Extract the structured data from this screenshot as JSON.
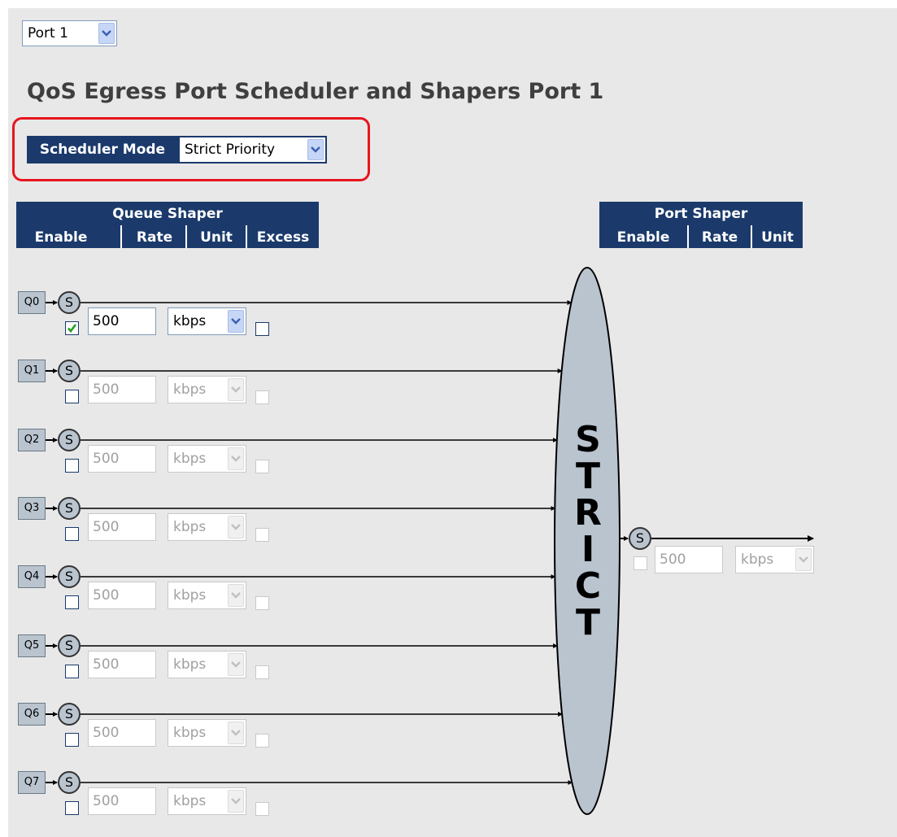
{
  "port_select": {
    "value": "Port 1"
  },
  "title": "QoS Egress Port Scheduler and Shapers  Port 1",
  "scheduler": {
    "label": "Scheduler Mode",
    "value": "Strict Priority"
  },
  "queue_shaper": {
    "header": "Queue Shaper",
    "columns": [
      "Enable",
      "Rate",
      "Unit",
      "Excess"
    ]
  },
  "port_shaper": {
    "header": "Port Shaper",
    "columns": [
      "Enable",
      "Rate",
      "Unit"
    ],
    "scheduler_symbol": "S",
    "enabled": false,
    "rate": "500",
    "unit": "kbps"
  },
  "strict_label": [
    "S",
    "T",
    "R",
    "I",
    "C",
    "T"
  ],
  "queues": [
    {
      "label": "Q0",
      "symbol": "S",
      "enabled": true,
      "rate": "500",
      "unit": "kbps",
      "excess": false
    },
    {
      "label": "Q1",
      "symbol": "S",
      "enabled": false,
      "rate": "500",
      "unit": "kbps",
      "excess": false
    },
    {
      "label": "Q2",
      "symbol": "S",
      "enabled": false,
      "rate": "500",
      "unit": "kbps",
      "excess": false
    },
    {
      "label": "Q3",
      "symbol": "S",
      "enabled": false,
      "rate": "500",
      "unit": "kbps",
      "excess": false
    },
    {
      "label": "Q4",
      "symbol": "S",
      "enabled": false,
      "rate": "500",
      "unit": "kbps",
      "excess": false
    },
    {
      "label": "Q5",
      "symbol": "S",
      "enabled": false,
      "rate": "500",
      "unit": "kbps",
      "excess": false
    },
    {
      "label": "Q6",
      "symbol": "S",
      "enabled": false,
      "rate": "500",
      "unit": "kbps",
      "excess": false
    },
    {
      "label": "Q7",
      "symbol": "S",
      "enabled": false,
      "rate": "500",
      "unit": "kbps",
      "excess": false
    }
  ],
  "icons": {
    "dropdown": "chevron-down-icon",
    "check": "check-icon",
    "arrow": "arrow-right-icon"
  }
}
